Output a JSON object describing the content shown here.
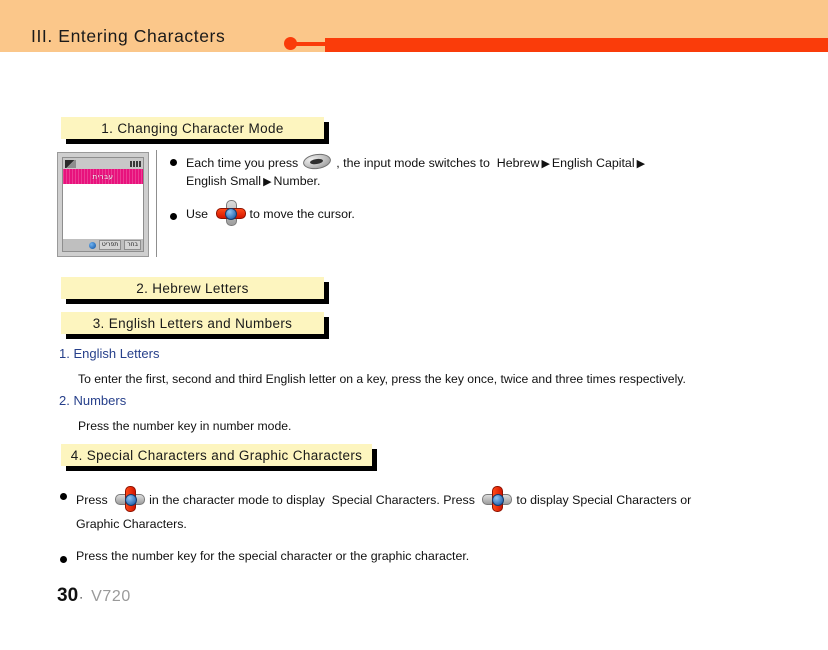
{
  "header": {
    "title": "III. Entering Characters",
    "accent_color": "#fa3c0a",
    "band_color": "#fbc78a"
  },
  "sections": [
    {
      "id": 1,
      "label": "1. Changing Character Mode"
    },
    {
      "id": 2,
      "label": "2. Hebrew Letters"
    },
    {
      "id": 3,
      "label": "3. English Letters and Numbers"
    },
    {
      "id": 4,
      "label": "4. Special Characters and Graphic Characters"
    }
  ],
  "phone_figure": {
    "title_bar_text": "עברית",
    "title_bar_color": "#e8127d",
    "softkey_left": "תפריט",
    "softkey_right": "בחר",
    "status_icons": [
      "signal-icon",
      "battery-icon"
    ]
  },
  "section1_bullets": {
    "bullet1": {
      "lead": "Each time you press",
      "icon": "key-button-icon",
      "after_icon": ", the input mode switches to",
      "mode1": "Hebrew",
      "arrow": "▶",
      "mode2": "English Capital",
      "mode3": "English Small",
      "mode4": "Number",
      "tail": "."
    },
    "bullet2": {
      "lead": "Use",
      "icon": "navigation-key-icon",
      "tail": "to move the cursor."
    }
  },
  "section3": {
    "subhead1": "1. English Letters",
    "para1": "To enter the first, second and third English letter on a key, press the key once, twice and three times respectively.",
    "subhead2": "2. Numbers",
    "para2": "Press the number key in number mode.",
    "subhead_color": "#27408b"
  },
  "section4_bullets": {
    "bullet1": {
      "lead": "Press",
      "icon1": "navigation-key-icon",
      "mid": "in the character mode to display",
      "target": "Special Characters",
      "after_target": ". Press",
      "icon2": "navigation-key-icon",
      "tail": "to display Special Characters or",
      "line2": "Graphic Characters."
    },
    "bullet2": {
      "text": "Press the number key for the special character or the graphic character."
    }
  },
  "footer": {
    "page_number": "30",
    "separator": "·",
    "model": "V720"
  }
}
